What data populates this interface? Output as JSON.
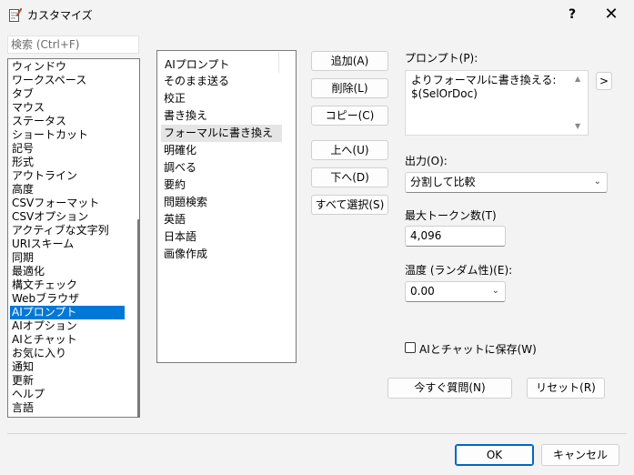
{
  "window": {
    "title": "カスタマイズ",
    "help": "?",
    "close": "✕"
  },
  "search": {
    "placeholder": "検索 (Ctrl+F)",
    "value": ""
  },
  "categories": [
    "ウィンドウ",
    "ワークスペース",
    "タブ",
    "マウス",
    "ステータス",
    "ショートカット",
    "記号",
    "形式",
    "アウトライン",
    "高度",
    "CSVフォーマット",
    "CSVオプション",
    "アクティブな文字列",
    "URIスキーム",
    "同期",
    "最適化",
    "構文チェック",
    "Webブラウザ",
    "AIプロンプト",
    "AIオプション",
    "AIとチャット",
    "お気に入り",
    "通知",
    "更新",
    "ヘルプ",
    "言語"
  ],
  "selected_category": "AIプロンプト",
  "prompt_list": {
    "header": "AIプロンプト",
    "items": [
      "そのまま送る",
      "校正",
      "書き換え",
      "フォーマルに書き換え",
      "明確化",
      "調べる",
      "要約",
      "問題検索",
      "英語",
      "日本語",
      "画像作成"
    ],
    "selected": "フォーマルに書き換え"
  },
  "buttons": {
    "add": "追加(A)",
    "delete": "削除(L)",
    "copy": "コピー(C)",
    "up": "上へ(U)",
    "down": "下へ(D)",
    "select_all": "すべて選択(S)",
    "ask_now": "今すぐ質問(N)",
    "reset": "リセット(R)",
    "ok": "OK",
    "cancel": "キャンセル",
    "expand": ">"
  },
  "prompt_field": {
    "label": "プロンプト(P):",
    "value": "よりフォーマルに書き換える:\n$(SelOrDoc)"
  },
  "output": {
    "label": "出力(O):",
    "value": "分割して比較"
  },
  "max_tokens": {
    "label": "最大トークン数(T)",
    "value": "4,096"
  },
  "temperature": {
    "label": "温度 (ランダム性)(E):",
    "value": "0.00"
  },
  "save_to_chat": {
    "label": "AIとチャットに保存(W)",
    "checked": false
  },
  "icons": {
    "app": "notepad-pencil-icon",
    "scroll_up": "triangle-up-icon",
    "scroll_down": "triangle-down-icon",
    "chevron": "chevron-down-icon"
  },
  "colors": {
    "selection": "#0078d7",
    "default_button_border": "#0067c0"
  }
}
